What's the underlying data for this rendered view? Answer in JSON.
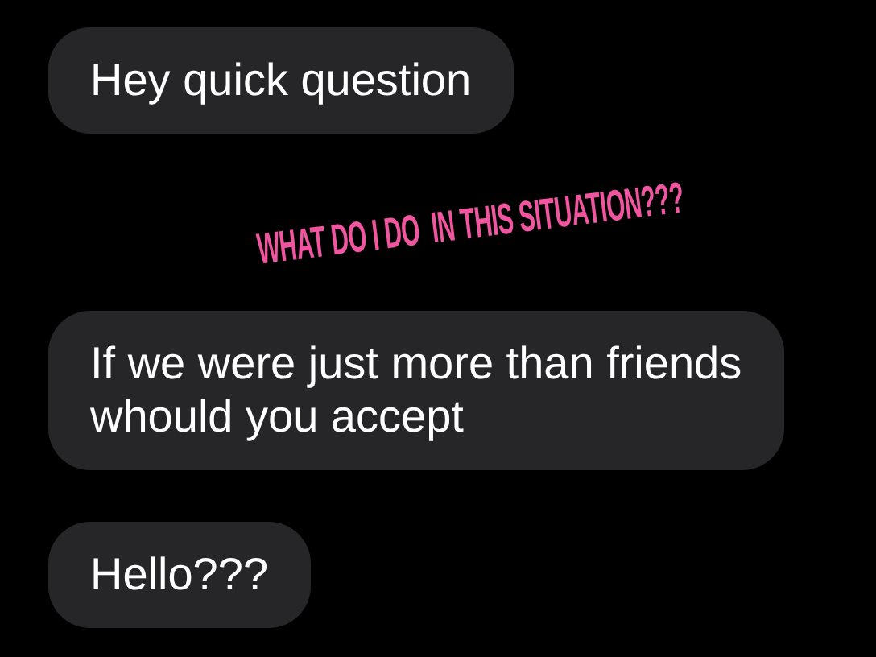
{
  "messages": [
    {
      "text": "Hey quick question"
    },
    {
      "text": "If we were just more than friends whould you accept"
    },
    {
      "text": "Hello???"
    }
  ],
  "overlay": {
    "text": "WHAT DO I DO  IN THIS SITUATION???"
  }
}
